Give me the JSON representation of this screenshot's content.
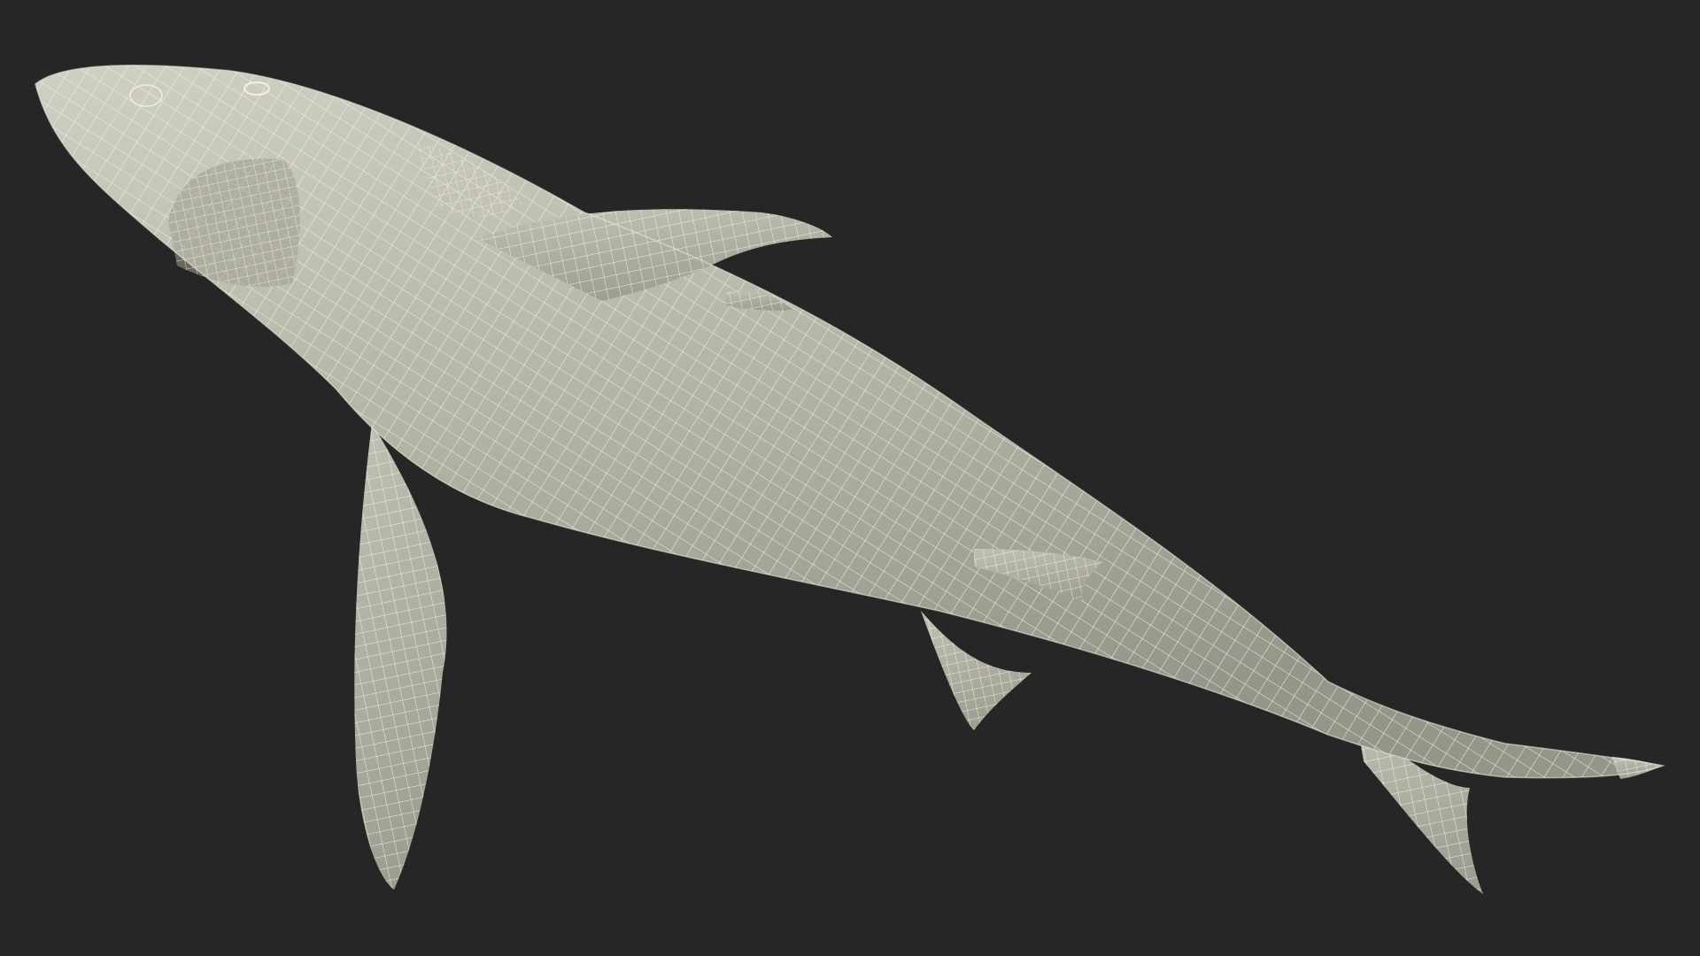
{
  "scene": {
    "background_color": "#262626",
    "subject": "shark-wireframe-model",
    "colors": {
      "body_light": "#c9c9bd",
      "body_mid": "#a9a99c",
      "body_dark": "#8a8a7e",
      "fin_fill": "#b3b3a6",
      "wire": "#f2f0e2"
    }
  }
}
